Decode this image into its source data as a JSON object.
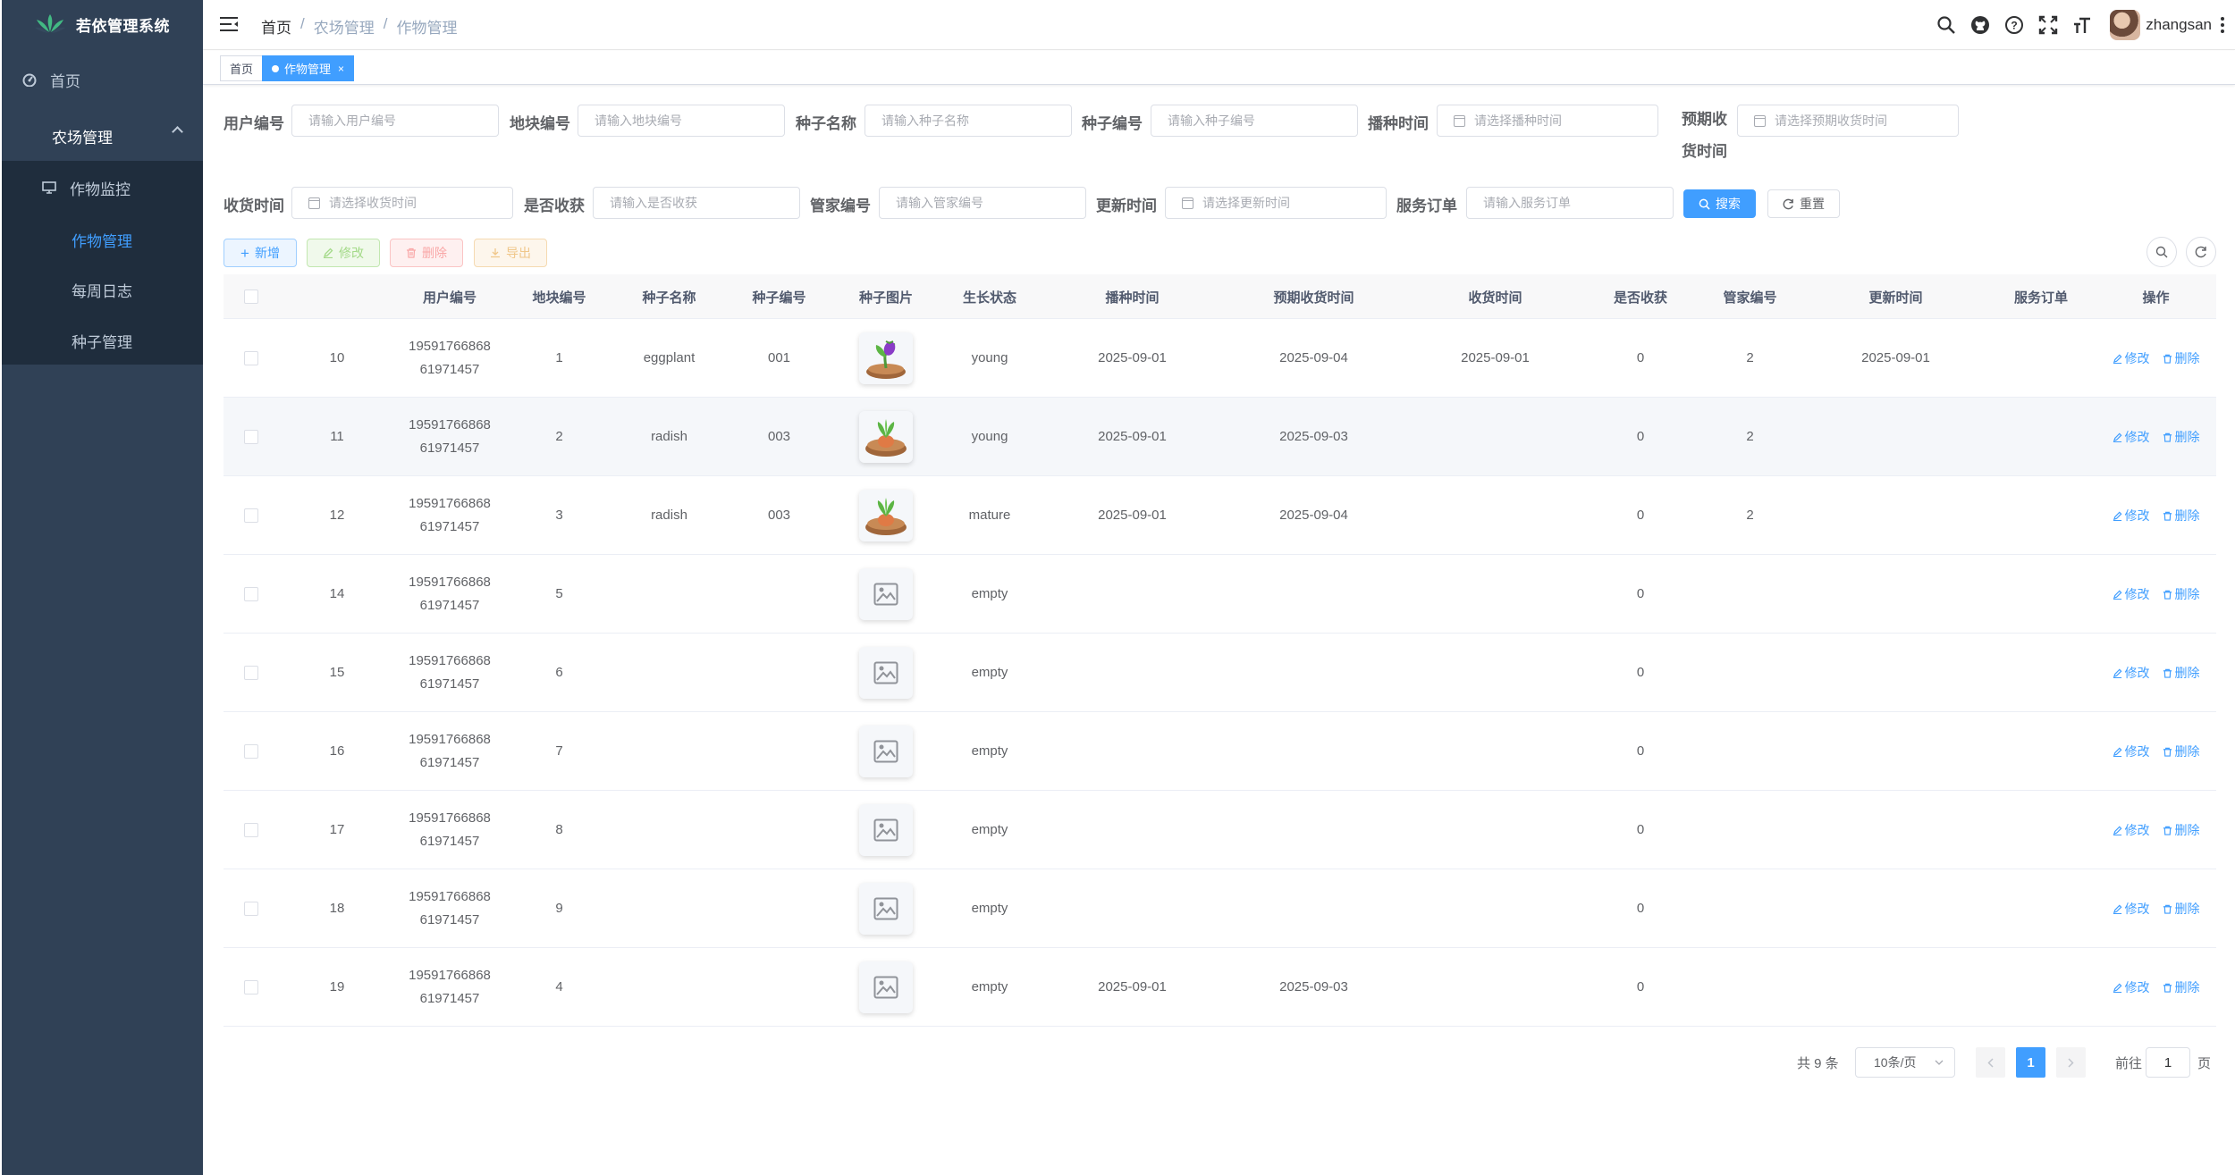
{
  "app": {
    "title": "若依管理系统"
  },
  "sidebar": {
    "items": [
      {
        "label": "首页",
        "icon": "dashboard-icon"
      },
      {
        "label": "农场管理",
        "icon": ""
      },
      {
        "label": "作物监控",
        "icon": "monitor-icon"
      },
      {
        "label": "作物管理",
        "icon": ""
      },
      {
        "label": "每周日志",
        "icon": ""
      },
      {
        "label": "种子管理",
        "icon": ""
      }
    ],
    "active_item": "作物管理"
  },
  "navbar": {
    "breadcrumb": [
      "首页",
      "农场管理",
      "作物管理"
    ],
    "icons": [
      "search-icon",
      "github-icon",
      "question-icon",
      "fullscreen-icon",
      "font-size-icon"
    ],
    "username": "zhangsan"
  },
  "tags": [
    {
      "label": "首页",
      "active": false
    },
    {
      "label": "作物管理",
      "active": true,
      "close": "×"
    }
  ],
  "search": {
    "fields": [
      {
        "label": "用户编号",
        "placeholder": "请输入用户编号",
        "type": "text"
      },
      {
        "label": "地块编号",
        "placeholder": "请输入地块编号",
        "type": "text"
      },
      {
        "label": "种子名称",
        "placeholder": "请输入种子名称",
        "type": "text"
      },
      {
        "label": "种子编号",
        "placeholder": "请输入种子编号",
        "type": "text"
      },
      {
        "label": "播种时间",
        "placeholder": "请选择播种时间",
        "type": "date"
      },
      {
        "label": "预期收货时间",
        "placeholder": "请选择预期收货时间",
        "type": "date"
      },
      {
        "label": "收货时间",
        "placeholder": "请选择收货时间",
        "type": "date"
      },
      {
        "label": "是否收获",
        "placeholder": "请输入是否收获",
        "type": "text"
      },
      {
        "label": "管家编号",
        "placeholder": "请输入管家编号",
        "type": "text"
      },
      {
        "label": "更新时间",
        "placeholder": "请选择更新时间",
        "type": "date"
      },
      {
        "label": "服务订单",
        "placeholder": "请输入服务订单",
        "type": "text"
      }
    ],
    "search_label": "搜索",
    "reset_label": "重置"
  },
  "toolbar": {
    "add_label": "新增",
    "edit_label": "修改",
    "delete_label": "删除",
    "export_label": "导出"
  },
  "table": {
    "columns": [
      "",
      "用户编号",
      "地块编号",
      "种子名称",
      "种子编号",
      "种子图片",
      "生长状态",
      "播种时间",
      "预期收货时间",
      "收货时间",
      "是否收获",
      "管家编号",
      "更新时间",
      "服务订单",
      "操作"
    ],
    "rows": [
      {
        "id": "10",
        "user": [
          "19591766868",
          "61971457"
        ],
        "plot": "1",
        "seed_name": "eggplant",
        "seed_no": "001",
        "image": "eggplant",
        "status": "young",
        "sow": "2025-09-01",
        "expected": "2025-09-04",
        "harvest": "2025-09-01",
        "harvested": "0",
        "keeper": "2",
        "updated": "2025-09-01",
        "order": ""
      },
      {
        "id": "11",
        "user": [
          "19591766868",
          "61971457"
        ],
        "plot": "2",
        "seed_name": "radish",
        "seed_no": "003",
        "image": "radish",
        "status": "young",
        "sow": "2025-09-01",
        "expected": "2025-09-03",
        "harvest": "",
        "harvested": "0",
        "keeper": "2",
        "updated": "",
        "order": ""
      },
      {
        "id": "12",
        "user": [
          "19591766868",
          "61971457"
        ],
        "plot": "3",
        "seed_name": "radish",
        "seed_no": "003",
        "image": "radish",
        "status": "mature",
        "sow": "2025-09-01",
        "expected": "2025-09-04",
        "harvest": "",
        "harvested": "0",
        "keeper": "2",
        "updated": "",
        "order": ""
      },
      {
        "id": "14",
        "user": [
          "19591766868",
          "61971457"
        ],
        "plot": "5",
        "seed_name": "",
        "seed_no": "",
        "image": "placeholder",
        "status": "empty",
        "sow": "",
        "expected": "",
        "harvest": "",
        "harvested": "0",
        "keeper": "",
        "updated": "",
        "order": ""
      },
      {
        "id": "15",
        "user": [
          "19591766868",
          "61971457"
        ],
        "plot": "6",
        "seed_name": "",
        "seed_no": "",
        "image": "placeholder",
        "status": "empty",
        "sow": "",
        "expected": "",
        "harvest": "",
        "harvested": "0",
        "keeper": "",
        "updated": "",
        "order": ""
      },
      {
        "id": "16",
        "user": [
          "19591766868",
          "61971457"
        ],
        "plot": "7",
        "seed_name": "",
        "seed_no": "",
        "image": "placeholder",
        "status": "empty",
        "sow": "",
        "expected": "",
        "harvest": "",
        "harvested": "0",
        "keeper": "",
        "updated": "",
        "order": ""
      },
      {
        "id": "17",
        "user": [
          "19591766868",
          "61971457"
        ],
        "plot": "8",
        "seed_name": "",
        "seed_no": "",
        "image": "placeholder",
        "status": "empty",
        "sow": "",
        "expected": "",
        "harvest": "",
        "harvested": "0",
        "keeper": "",
        "updated": "",
        "order": ""
      },
      {
        "id": "18",
        "user": [
          "19591766868",
          "61971457"
        ],
        "plot": "9",
        "seed_name": "",
        "seed_no": "",
        "image": "placeholder",
        "status": "empty",
        "sow": "",
        "expected": "",
        "harvest": "",
        "harvested": "0",
        "keeper": "",
        "updated": "",
        "order": ""
      },
      {
        "id": "19",
        "user": [
          "19591766868",
          "61971457"
        ],
        "plot": "4",
        "seed_name": "",
        "seed_no": "",
        "image": "placeholder",
        "status": "empty",
        "sow": "2025-09-01",
        "expected": "2025-09-03",
        "harvest": "",
        "harvested": "0",
        "keeper": "",
        "updated": "",
        "order": ""
      }
    ],
    "row_actions": {
      "edit": "修改",
      "delete": "删除"
    }
  },
  "pagination": {
    "total_label": "共 9 条",
    "page_size": "10条/页",
    "current_page": "1",
    "goto_prefix": "前往",
    "goto_value": "1",
    "goto_suffix": "页"
  },
  "colors": {
    "primary": "#409eff",
    "sidebar_bg": "#304156",
    "submenu_bg": "#1f2d3d"
  }
}
